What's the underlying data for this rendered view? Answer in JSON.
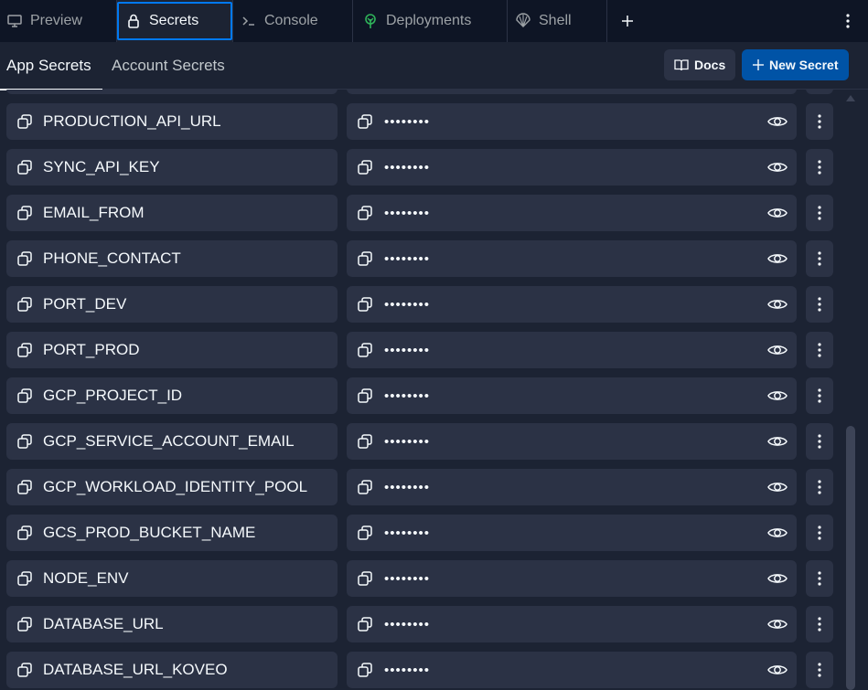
{
  "tabs": [
    {
      "label": "Preview",
      "icon": "monitor-icon",
      "active": false
    },
    {
      "label": "Secrets",
      "icon": "lock-icon",
      "active": true
    },
    {
      "label": "Console",
      "icon": "terminal-icon",
      "active": false
    },
    {
      "label": "Deployments",
      "icon": "deployments-icon",
      "active": false
    },
    {
      "label": "Shell",
      "icon": "shell-icon",
      "active": false
    }
  ],
  "subtabs": {
    "app": "App Secrets",
    "account": "Account Secrets"
  },
  "buttons": {
    "docs": "Docs",
    "new_secret": "New Secret"
  },
  "masked_value": "••••••••",
  "secrets": [
    "PRODUCTION_API_URL",
    "SYNC_API_KEY",
    "EMAIL_FROM",
    "PHONE_CONTACT",
    "PORT_DEV",
    "PORT_PROD",
    "GCP_PROJECT_ID",
    "GCP_SERVICE_ACCOUNT_EMAIL",
    "GCP_WORKLOAD_IDENTITY_POOL",
    "GCS_PROD_BUCKET_NAME",
    "NODE_ENV",
    "DATABASE_URL",
    "DATABASE_URL_KOVEO"
  ],
  "colors": {
    "accent": "#0079f2",
    "primary_button": "#0053a6",
    "surface": "#2b3245",
    "background": "#1c2333",
    "tabbar": "#0e1525"
  }
}
